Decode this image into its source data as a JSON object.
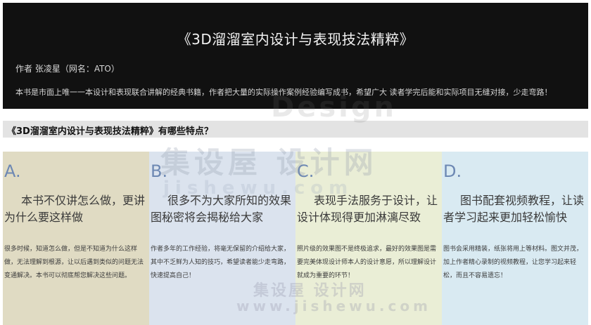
{
  "hero": {
    "title": "《3D溜溜室内设计与表现技法精粹》",
    "author": "作者 张凌星（网名：ATO）",
    "description": "本书是市面上唯一一本设计和表现联合讲解的经典书籍，作者把大量的实际操作案例经验编写成书，希望广大 读者学完后能和实际项目无缝对接，少走弯路！"
  },
  "section": {
    "title": "《3D溜溜室内设计与表现技法精粹》有哪些特点？"
  },
  "cards": [
    {
      "letter": "A.",
      "heading": "本书不仅讲怎么做，更讲为什么要这样做",
      "body": "很多时候，知道怎么做，但是不知道为什么这样做，无法理解到根源，让以后遇到类似的问题无法变通解决。本书可以彻底帮您解决这些问题。",
      "bg": "#e0dbc3",
      "accent": "#6d88b3"
    },
    {
      "letter": "B.",
      "heading": "很多不为大家所知的效果图秘密将会揭秘给大家",
      "body": "作者多年的工作经验，将毫无保留的介绍给大家，其中不乏鲜为人知的技巧，希望读者能少走弯路，快速提高自己！",
      "bg": "#dbe3ee",
      "accent": "#6d88b3"
    },
    {
      "letter": "C.",
      "heading": "表现手法服务于设计，让设计体现得更加淋漓尽致",
      "body": "照片级的效果图不是终极追求，最好的效果图是需要完美体现设计师本人的设计意愿，所以理解设计就成为重要的环节！",
      "bg": "#eaeed6",
      "accent": "#6d88b3"
    },
    {
      "letter": "D.",
      "heading": "图书配套视频教程，让读者学习起来更加轻松愉快",
      "body": "图书会采用精装，纸张将用上等材料。图文并茂，加上作者精心录制的视频教程，让您学习起来轻松，而且不容易遗忘！",
      "bg": "#d9eaf2",
      "accent": "#6d88b3"
    }
  ],
  "watermarks": [
    "Design",
    "集设屋 设计网",
    "jishewu.com",
    "集设屋 设计网",
    "www.jishewu.com"
  ],
  "colors": {
    "hero_bg": "#111111",
    "section_bar_bg": "#e3e3e3",
    "letter_color": "#6d88b3"
  }
}
